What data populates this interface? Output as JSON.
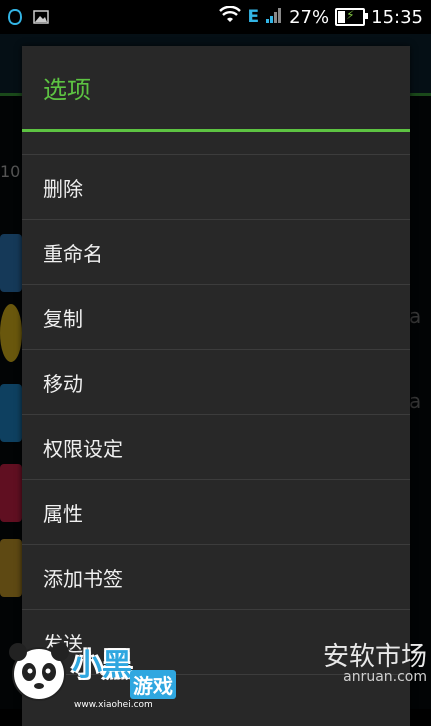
{
  "status_bar": {
    "network": "E",
    "battery": "27%",
    "time": "15:35"
  },
  "dialog": {
    "title": "选项",
    "items": [
      "删除",
      "重命名",
      "复制",
      "移动",
      "权限设定",
      "属性",
      "添加书签",
      "发送"
    ]
  },
  "background": {
    "peek_text": [
      "10",
      "a",
      "a"
    ]
  },
  "watermark": {
    "left_main": "小黑",
    "left_sub": "游戏",
    "left_url": "www.xiaohei.com",
    "right_main": "安软市场",
    "right_url": "anruan.com"
  },
  "colors": {
    "accent": "#5dc342",
    "dialog_bg": "#282828",
    "net": "#33b5e5"
  }
}
